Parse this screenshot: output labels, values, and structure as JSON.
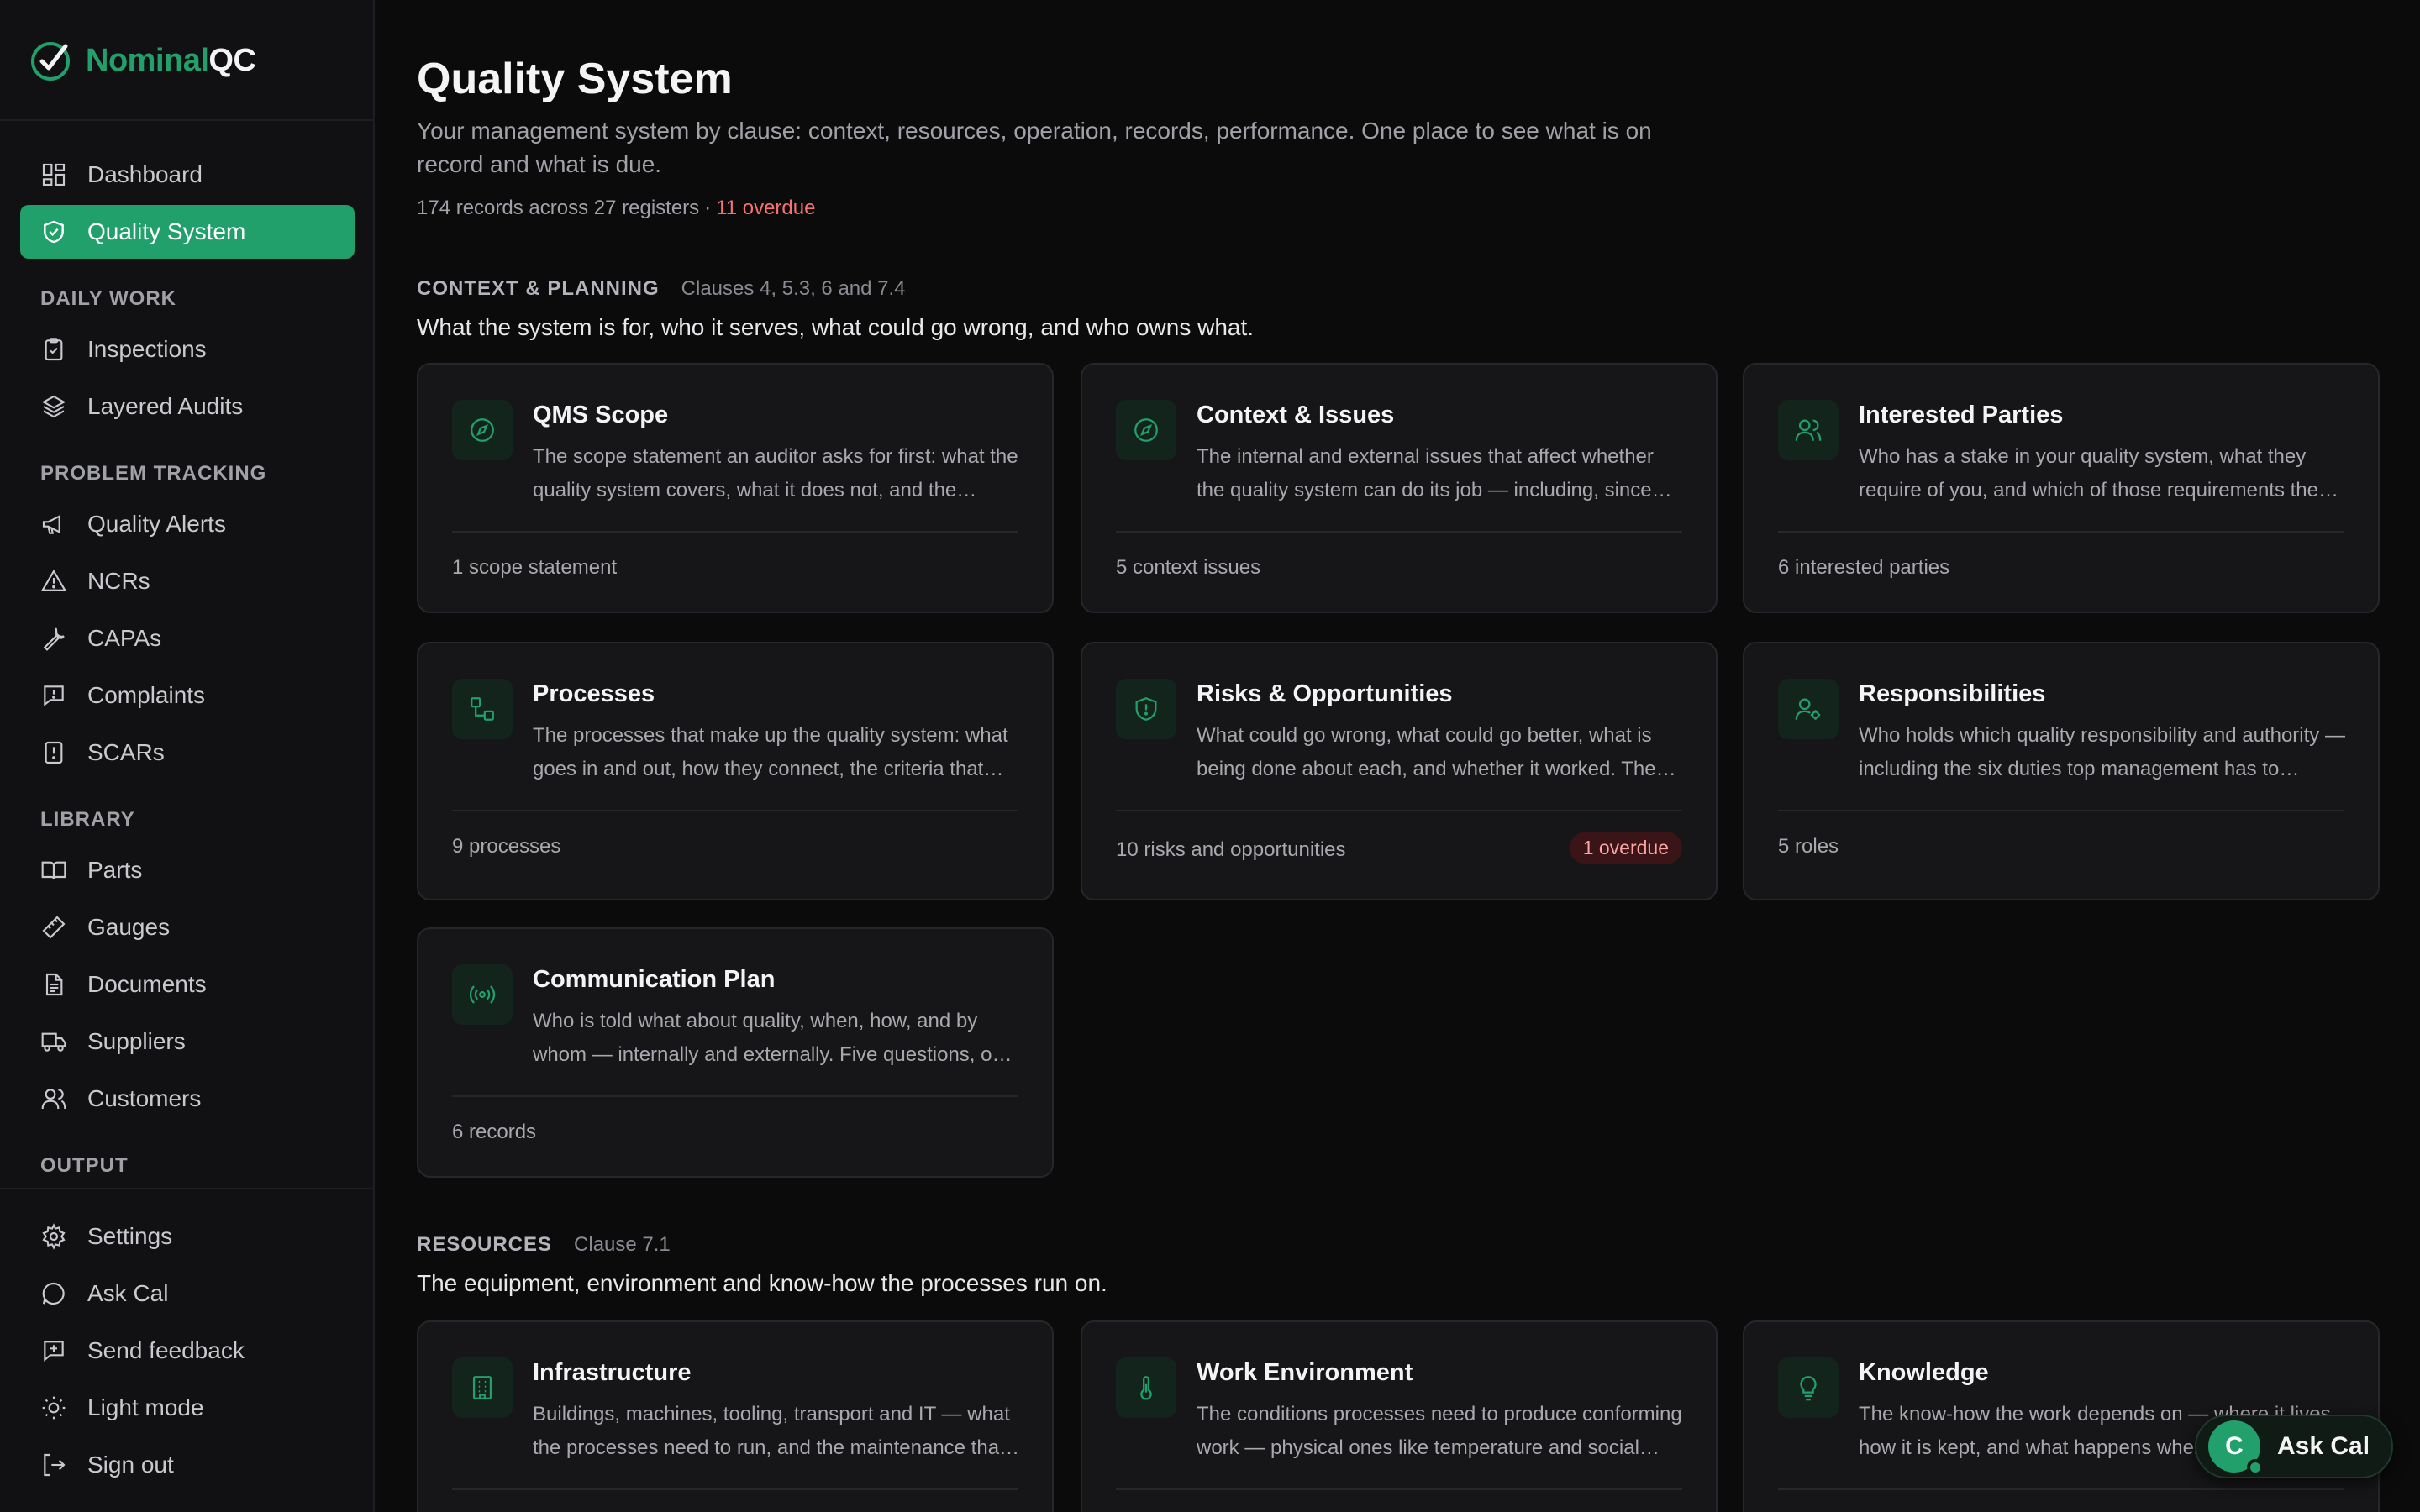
{
  "brand": {
    "name_a": "Nominal",
    "name_b": "QC"
  },
  "nav": {
    "dashboard": "Dashboard",
    "quality_system": "Quality System",
    "sections": {
      "daily_work": "DAILY WORK",
      "problem_tracking": "PROBLEM TRACKING",
      "library": "LIBRARY",
      "output": "OUTPUT"
    },
    "inspections": "Inspections",
    "layered_audits": "Layered Audits",
    "quality_alerts": "Quality Alerts",
    "ncrs": "NCRs",
    "capas": "CAPAs",
    "complaints": "Complaints",
    "scars": "SCARs",
    "parts": "Parts",
    "gauges": "Gauges",
    "documents": "Documents",
    "suppliers": "Suppliers",
    "customers": "Customers",
    "settings": "Settings",
    "ask_cal": "Ask Cal",
    "send_feedback": "Send feedback",
    "light_mode": "Light mode",
    "sign_out": "Sign out"
  },
  "page": {
    "title": "Quality System",
    "subtitle": "Your management system by clause: context, resources, operation, records, performance. One place to see what is on record and what is due.",
    "meta_records": "174 records across 27 registers",
    "meta_dot": "·",
    "meta_overdue": "11 overdue"
  },
  "context_section": {
    "name": "CONTEXT & PLANNING",
    "clause": "Clauses 4, 5.3, 6 and 7.4",
    "desc": "What the system is for, who it serves, what could go wrong, and who owns what.",
    "cards": [
      {
        "title": "QMS Scope",
        "desc": "The scope statement an auditor asks for first: what the quality system covers, what it does not, and the reasons for any exclusions.",
        "foot": "1 scope statement",
        "icon": "compass-icon"
      },
      {
        "title": "Context & Issues",
        "desc": "The internal and external issues that affect whether the quality system can do its job — including, since recent revisions, climate change.",
        "foot": "5 context issues",
        "icon": "compass-icon"
      },
      {
        "title": "Interested Parties",
        "desc": "Who has a stake in your quality system, what they require of you, and which of those requirements the system addresses.",
        "foot": "6 interested parties",
        "icon": "users-icon"
      },
      {
        "title": "Processes",
        "desc": "The processes that make up the quality system: what goes in and out, how they connect, the criteria that control them.",
        "foot": "9 processes",
        "icon": "workflow-icon"
      },
      {
        "title": "Risks & Opportunities",
        "desc": "What could go wrong, what could go better, what is being done about each, and whether it worked. The record auditors ask for.",
        "foot": "10 risks and opportunities",
        "badge": "1 overdue",
        "icon": "shield-alert-icon"
      },
      {
        "title": "Responsibilities",
        "desc": "Who holds which quality responsibility and authority — including the six duties top management has to assign.",
        "foot": "5 roles",
        "icon": "user-cog-icon"
      },
      {
        "title": "Communication Plan",
        "desc": "Who is told what about quality, when, how, and by whom — internally and externally. Five questions, one record each.",
        "foot": "6 records",
        "icon": "broadcast-icon"
      }
    ]
  },
  "resources_section": {
    "name": "RESOURCES",
    "clause": "Clause 7.1",
    "desc": "The equipment, environment and know-how the processes run on.",
    "cards": [
      {
        "title": "Infrastructure",
        "desc": "Buildings, machines, tooling, transport and IT — what the processes need to run, and the maintenance that keeps them running.",
        "icon": "building-icon"
      },
      {
        "title": "Work Environment",
        "desc": "The conditions processes need to produce conforming work — physical ones like temperature and social ones like calm.",
        "icon": "thermometer-icon"
      },
      {
        "title": "Knowledge",
        "desc": "The know-how the work depends on — where it lives, how it is kept, and what happens when people leave.",
        "icon": "lightbulb-icon"
      }
    ]
  },
  "ask_button": {
    "avatar": "C",
    "label": "Ask Cal"
  },
  "colors": {
    "accent": "#22a06b",
    "overdue": "#f87171",
    "background": "#0b0b0c",
    "card": "#161618"
  }
}
